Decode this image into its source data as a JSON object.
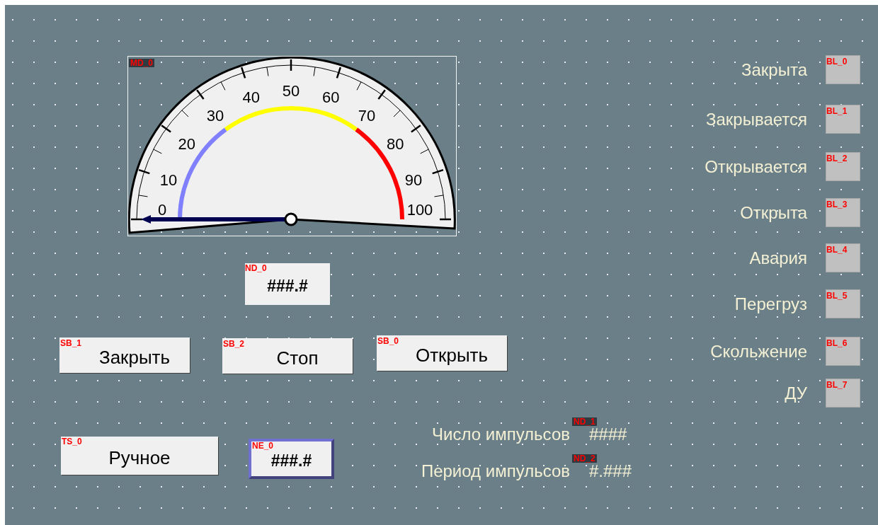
{
  "canvas": {
    "gauge": {
      "tag": "MD_0",
      "scale_labels": [
        "0",
        "10",
        "20",
        "30",
        "40",
        "50",
        "60",
        "70",
        "80",
        "90",
        "100"
      ],
      "level": 0
    },
    "value_display": {
      "tag": "ND_0",
      "value": "###.#"
    },
    "buttons": [
      {
        "tag": "SB_1",
        "label": "Закрыть"
      },
      {
        "tag": "SB_2",
        "label": "Стоп"
      },
      {
        "tag": "SB_0",
        "label": "Открыть"
      }
    ],
    "toggle_switch": {
      "tag": "TS_0",
      "label": "Ручное",
      "on": false
    },
    "numeric_entry": {
      "tag": "NE_0",
      "value": "###.#"
    },
    "readouts": [
      {
        "label": "Число импульсов",
        "tag": "ND_1",
        "value": "####"
      },
      {
        "label": "Период импульсов",
        "tag": "ND_2",
        "value": "#.###"
      }
    ],
    "lamps": [
      {
        "label": "Закрыта",
        "tag": "BL_0"
      },
      {
        "label": "Закрывается",
        "tag": "BL_1"
      },
      {
        "label": "Открывается",
        "tag": "BL_2"
      },
      {
        "label": "Открыта",
        "tag": "BL_3"
      },
      {
        "label": "Авария",
        "tag": "BL_4"
      },
      {
        "label": "Перегруз",
        "tag": "BL_5"
      },
      {
        "label": "Скольжение",
        "tag": "BL_6"
      },
      {
        "label": "ДУ",
        "tag": "BL_7"
      }
    ]
  }
}
